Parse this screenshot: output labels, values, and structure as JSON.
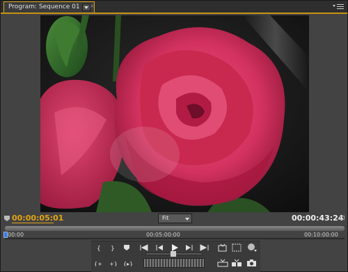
{
  "tab": {
    "label": "Program: Sequence 01",
    "close_glyph": "×"
  },
  "controls": {
    "current_timecode": "00:00:05:01",
    "duration_timecode": "00:00:43:24",
    "zoom_select": "Fit"
  },
  "ruler": {
    "labels": [
      "00:00",
      "00:05:00:00",
      "00:10:00:00"
    ],
    "playhead_position_fraction": 0.0
  },
  "icons": {
    "panel_menu": "panel-menu-icon",
    "set_marker": "marker-icon",
    "transport": [
      "set-in-icon",
      "set-out-icon",
      "set-marker-icon",
      "go-to-in-icon",
      "step-back-icon",
      "play-icon",
      "step-forward-icon",
      "go-to-out-icon",
      "lift-icon",
      "extract-icon",
      "output-icon",
      "loop-icon",
      "play-in-to-out-icon",
      "safe-margins-icon",
      "trim-icon",
      "export-frame-icon"
    ]
  },
  "colors": {
    "accent": "#e3a412",
    "panel": "#434343",
    "tab_border": "#d9a51a"
  }
}
